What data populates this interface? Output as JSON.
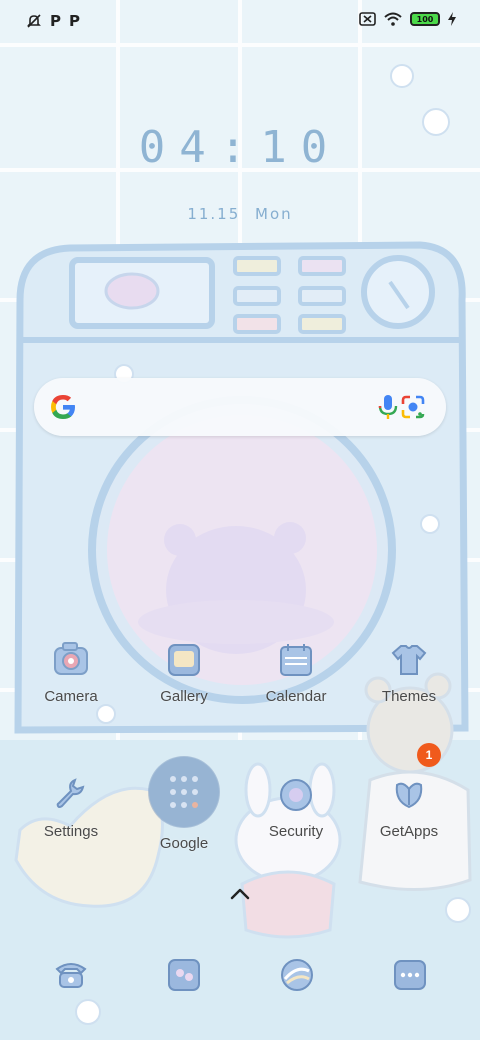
{
  "status_bar": {
    "left_icons": [
      "notification-muted-icon",
      "p-app-icon",
      "p-app-icon"
    ],
    "left_glyphs": [
      "P",
      "P"
    ],
    "right_icons": [
      "no-sim-icon",
      "wifi-icon",
      "battery-icon",
      "charging-icon"
    ],
    "battery_level": "100"
  },
  "clock": {
    "time": "04:10"
  },
  "date": {
    "date": "11.15",
    "weekday": "Mon"
  },
  "search": {
    "icons": [
      "google-logo-icon",
      "microphone-icon",
      "google-lens-icon"
    ],
    "colors": {
      "blue": "#4285F4",
      "red": "#EA4335",
      "yellow": "#FBBC05",
      "green": "#34A853"
    }
  },
  "apps_row1": [
    {
      "label": "Camera",
      "icon": "camera-icon"
    },
    {
      "label": "Gallery",
      "icon": "gallery-icon"
    },
    {
      "label": "Calendar",
      "icon": "calendar-icon"
    },
    {
      "label": "Themes",
      "icon": "shirt-icon"
    }
  ],
  "apps_row2": [
    {
      "label": "Settings",
      "icon": "wrench-icon"
    },
    {
      "label": "Google",
      "icon": "folder-icon"
    },
    {
      "label": "Security",
      "icon": "security-icon"
    },
    {
      "label": "GetApps",
      "icon": "tulip-icon",
      "badge": "1"
    }
  ],
  "app_drawer": {
    "icon": "chevron-up-icon"
  },
  "dock": [
    "phone-icon",
    "messages-icon",
    "browser-icon",
    "more-apps-icon"
  ],
  "theme_colors": {
    "wallpaper": "#e6f2f8",
    "outline": "#a8c8e4",
    "clock": "#8fb4d3",
    "badge": "#f05a1c"
  }
}
